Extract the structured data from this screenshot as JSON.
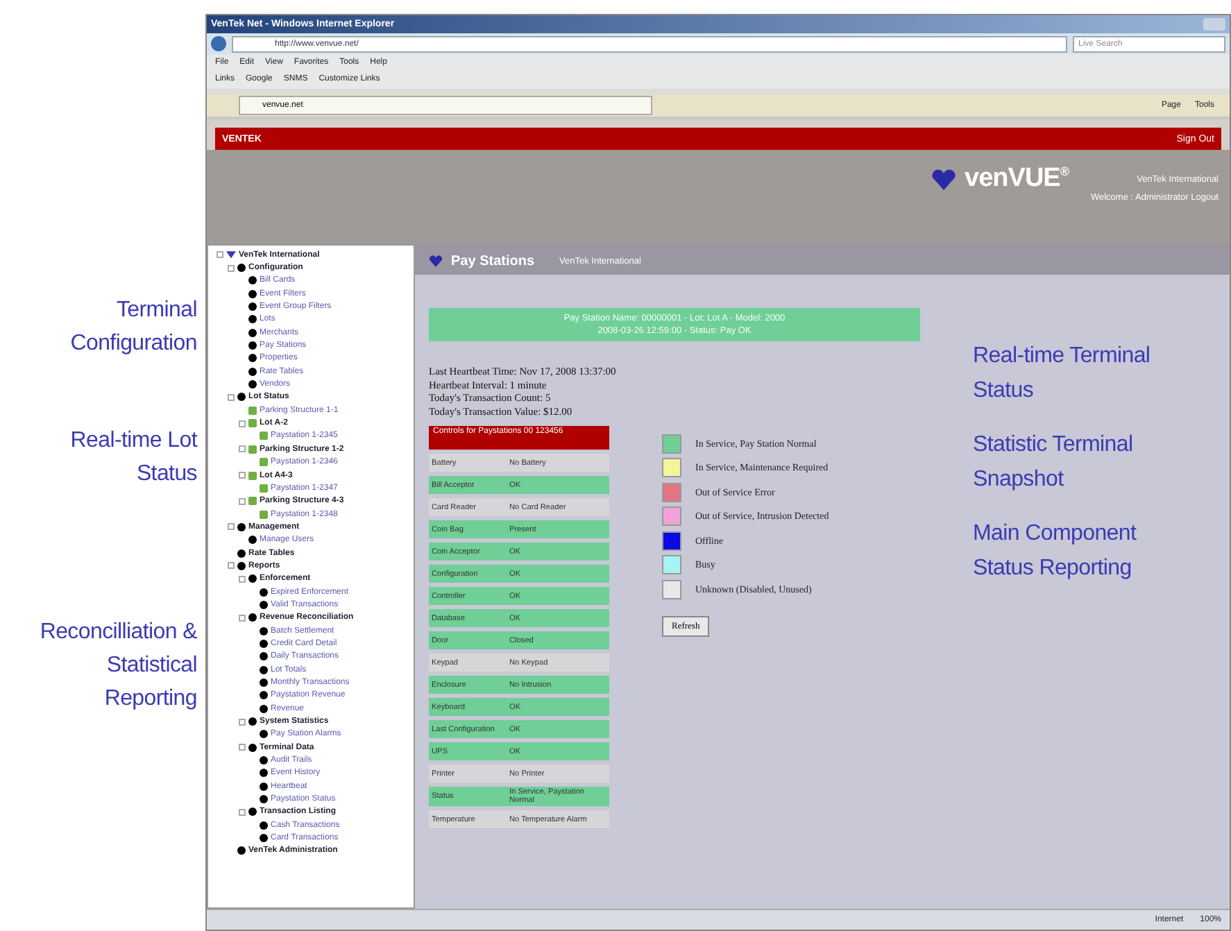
{
  "annotations_left": [
    "Terminal Configuration",
    "Real-time Lot Status",
    "Reconcilliation & Statistical Reporting"
  ],
  "browser": {
    "title": "VenTek Net - Windows Internet Explorer",
    "address": "http://www.venvue.net/",
    "search_placeholder": "Live Search",
    "menu": [
      "File",
      "Edit",
      "View",
      "Favorites",
      "Tools",
      "Help"
    ],
    "links": [
      "Links",
      "Google",
      "SNMS",
      "Customize Links"
    ],
    "tab": "venvue.net",
    "toolbar": [
      "Page",
      "Tools"
    ]
  },
  "header": {
    "brand": "VENTEK",
    "sign_out": "Sign Out",
    "logo": "venVUE",
    "logo_mark": "®",
    "org": "VenTek International",
    "user": "Welcome : Administrator Logout"
  },
  "tree": {
    "label": "VenTek International",
    "children": [
      {
        "label": "Configuration",
        "children": [
          {
            "label": "Bill Cards"
          },
          {
            "label": "Event Filters"
          },
          {
            "label": "Event Group Filters"
          },
          {
            "label": "Lots"
          },
          {
            "label": "Merchants"
          },
          {
            "label": "Pay Stations"
          },
          {
            "label": "Properties"
          },
          {
            "label": "Rate Tables"
          },
          {
            "label": "Vendors"
          }
        ]
      },
      {
        "label": "Lot Status",
        "children": [
          {
            "label": "Parking Structure 1-1",
            "kind": "lot"
          },
          {
            "label": "Lot A-2",
            "kind": "lot",
            "children": [
              {
                "label": "Paystation 1-2345",
                "kind": "lot"
              }
            ]
          },
          {
            "label": "Parking Structure 1-2",
            "kind": "lot",
            "children": [
              {
                "label": "Paystation 1-2346",
                "kind": "lot"
              }
            ]
          },
          {
            "label": "Lot A4-3",
            "kind": "lot",
            "children": [
              {
                "label": "Paystation 1-2347",
                "kind": "lot"
              }
            ]
          },
          {
            "label": "Parking Structure 4-3",
            "kind": "lot",
            "children": [
              {
                "label": "Paystation 1-2348",
                "kind": "lot"
              }
            ]
          }
        ]
      },
      {
        "label": "Management",
        "children": [
          {
            "label": "Manage Users"
          }
        ]
      },
      {
        "label": "Rate Tables"
      },
      {
        "label": "Reports",
        "children": [
          {
            "label": "Enforcement",
            "children": [
              {
                "label": "Expired Enforcement"
              },
              {
                "label": "Valid Transactions"
              }
            ]
          },
          {
            "label": "Revenue Reconciliation",
            "children": [
              {
                "label": "Batch Settlement"
              },
              {
                "label": "Credit Card Detail"
              },
              {
                "label": "Daily Transactions"
              },
              {
                "label": "Lot Totals"
              },
              {
                "label": "Monthly Transactions"
              },
              {
                "label": "Paystation Revenue"
              },
              {
                "label": "Revenue"
              }
            ]
          },
          {
            "label": "System Statistics",
            "children": [
              {
                "label": "Pay Station Alarms"
              }
            ]
          },
          {
            "label": "Terminal Data",
            "children": [
              {
                "label": "Audit Trails"
              },
              {
                "label": "Event History"
              },
              {
                "label": "Heartbeat"
              },
              {
                "label": "Paystation Status"
              }
            ]
          },
          {
            "label": "Transaction Listing",
            "children": [
              {
                "label": "Cash Transactions"
              },
              {
                "label": "Card Transactions"
              }
            ]
          }
        ]
      },
      {
        "label": "VenTek Administration"
      }
    ]
  },
  "main": {
    "title": "Pay Stations",
    "subtitle": "VenTek International",
    "banner": [
      "Pay Station Name: 00000001 - Lot: Lot A - Model: 2000",
      "2008-03-26 12:59:00 - Status: Pay OK"
    ],
    "info": [
      "Last Heartbeat Time: Nov 17, 2008 13:37:00",
      "Heartbeat Interval: 1 minute",
      "Today's Transaction Count: 5",
      "Today's Transaction Value: $12.00"
    ],
    "components_title": "Controls for Paystations 00 123456",
    "components": [
      {
        "name": "Battery",
        "value": "No Battery",
        "color": "#d6d6d8"
      },
      {
        "name": "Bill Acceptor",
        "value": "OK",
        "color": "#6fcf96"
      },
      {
        "name": "Card Reader",
        "value": "No Card Reader",
        "color": "#d6d6d8"
      },
      {
        "name": "Coin Bag",
        "value": "Present",
        "color": "#6fcf96"
      },
      {
        "name": "Coin Acceptor",
        "value": "OK",
        "color": "#6fcf96"
      },
      {
        "name": "Configuration",
        "value": "OK",
        "color": "#6fcf96"
      },
      {
        "name": "Controller",
        "value": "OK",
        "color": "#6fcf96"
      },
      {
        "name": "Database",
        "value": "OK",
        "color": "#6fcf96"
      },
      {
        "name": "Door",
        "value": "Closed",
        "color": "#6fcf96"
      },
      {
        "name": "Keypad",
        "value": "No Keypad",
        "color": "#d6d6d8"
      },
      {
        "name": "Enclosure",
        "value": "No Intrusion",
        "color": "#6fcf96"
      },
      {
        "name": "Keyboard",
        "value": "OK",
        "color": "#6fcf96"
      },
      {
        "name": "Last Configuration",
        "value": "OK",
        "color": "#6fcf96"
      },
      {
        "name": "UPS",
        "value": "OK",
        "color": "#6fcf96"
      },
      {
        "name": "Printer",
        "value": "No Printer",
        "color": "#d6d6d8"
      },
      {
        "name": "Status",
        "value": "In Service, Paystation Normal",
        "color": "#6fcf96"
      },
      {
        "name": "Temperature",
        "value": "No Temperature Alarm",
        "color": "#d6d6d8"
      }
    ],
    "legend": [
      {
        "label": "In Service, Pay Station Normal",
        "color": "#6fcf96"
      },
      {
        "label": "In Service, Maintenance Required",
        "color": "#f4f49c"
      },
      {
        "label": "Out of Service Error",
        "color": "#e27584"
      },
      {
        "label": "Out of Service, Intrusion Detected",
        "color": "#f0a2d8"
      },
      {
        "label": "Offline",
        "color": "#0a0ae0"
      },
      {
        "label": "Busy",
        "color": "#a4f4f4"
      },
      {
        "label": "Unknown (Disabled, Unused)",
        "color": "#e8e8ea"
      }
    ],
    "refresh": "Refresh"
  },
  "annotations_right": [
    "Real-time Terminal Status",
    "Statistic Terminal Snapshot",
    "Main Component Status Reporting"
  ],
  "status_bar": {
    "zone": "Internet",
    "zoom": "100%"
  }
}
